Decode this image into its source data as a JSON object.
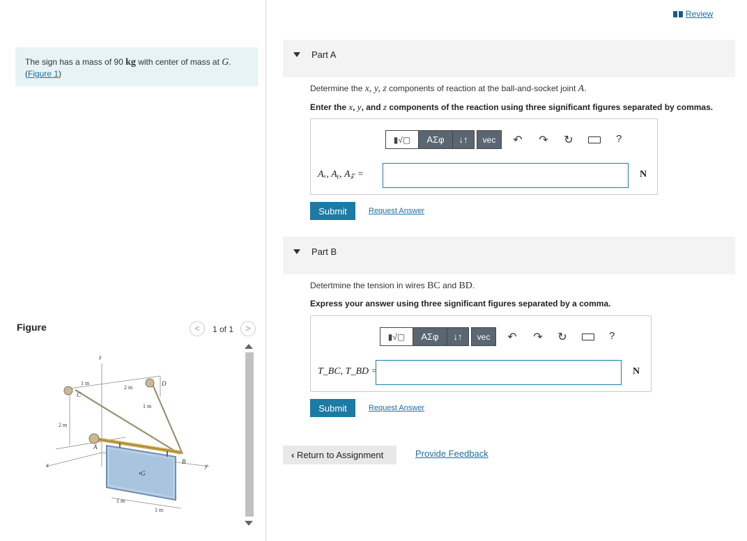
{
  "review": {
    "label": "Review"
  },
  "problem": {
    "text_before": "The sign has a mass of 90 ",
    "unit": "kg",
    "text_middle": " with center of mass at ",
    "point": "G",
    "text_after": ".",
    "figure_link": "Figure 1"
  },
  "figure": {
    "heading": "Figure",
    "pager": {
      "prev": "<",
      "count": "1 of 1",
      "next": ">"
    },
    "labels": {
      "z": "z",
      "x": "x",
      "y": "y",
      "C": "C",
      "D": "D",
      "A": "A",
      "B": "B",
      "G": "•G",
      "dim_1m_top": "1 m",
      "dim_2m_top": "2 m",
      "dim_1m_mid": "1 m",
      "dim_2m_side": "2 m",
      "dim_1m_bot_left": "1 m",
      "dim_1m_bot_right": "1 m"
    }
  },
  "partA": {
    "header": "Part A",
    "question_before": "Determine the ",
    "question_vars": "x, y, z",
    "question_middle": " components of reaction at the ball-and-socket joint ",
    "question_point": "A",
    "question_after": ".",
    "instr_before": "Enter the ",
    "instr_x": "x",
    "instr_mid1": ", ",
    "instr_y": "y",
    "instr_mid2": ", and ",
    "instr_z": "z",
    "instr_after": " components of the reaction using three significant figures separated by commas.",
    "answer_label": "Aₓ, Aᵧ, A𝓏 =",
    "answer_value": "",
    "unit": "N",
    "submit": "Submit",
    "request": "Request Answer"
  },
  "partB": {
    "header": "Part B",
    "question_before": "Detertmine the tension in wires ",
    "question_bc": "BC",
    "question_middle": " and ",
    "question_bd": "BD",
    "question_after": ".",
    "instruction": "Express your answer using three significant figures separated by a comma.",
    "answer_label": "T_BC, T_BD =",
    "answer_value": "",
    "unit": "N",
    "submit": "Submit",
    "request": "Request Answer"
  },
  "toolbar": {
    "templates": "▮√▢",
    "greek": "ΑΣφ",
    "arrows": "↓↑",
    "vec": "vec",
    "undo": "↶",
    "redo": "↷",
    "reset": "↻",
    "keyboard": "keyboard-icon",
    "help": "?"
  },
  "footer": {
    "return": "Return to Assignment",
    "feedback": "Provide Feedback"
  }
}
